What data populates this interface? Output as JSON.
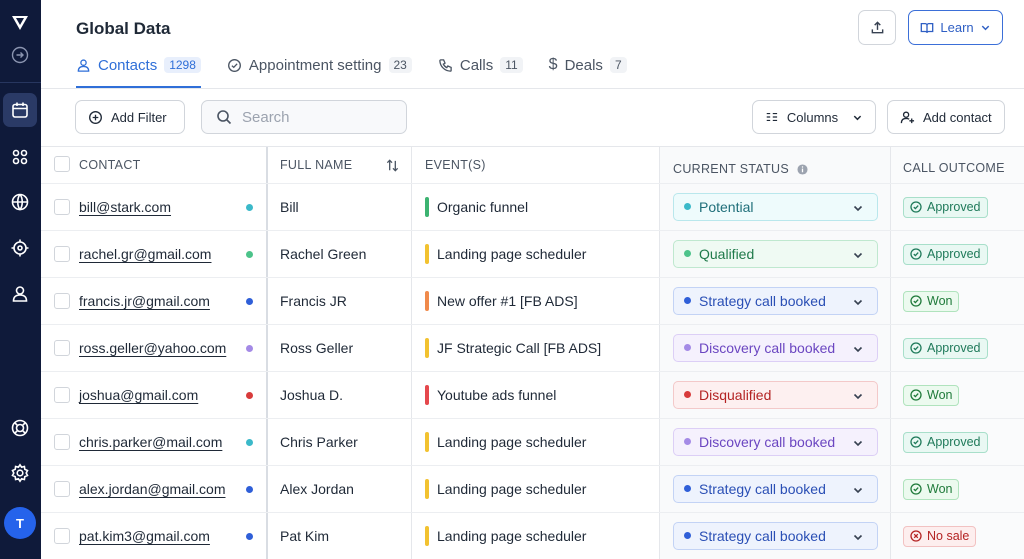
{
  "header": {
    "title": "Global Data",
    "learn_label": "Learn"
  },
  "tabs": [
    {
      "label": "Contacts",
      "count": "1298",
      "icon": "contacts-icon"
    },
    {
      "label": "Appointment setting",
      "count": "23",
      "icon": "check-circle-icon"
    },
    {
      "label": "Calls",
      "count": "11",
      "icon": "phone-icon"
    },
    {
      "label": "Deals",
      "count": "7",
      "icon": "dollar-icon"
    }
  ],
  "toolbar": {
    "add_filter": "Add Filter",
    "search_placeholder": "Search",
    "columns": "Columns",
    "add_contact": "Add contact"
  },
  "columns": {
    "contact": "CONTACT",
    "full_name": "FULL NAME",
    "events": "EVENT(S)",
    "current_status": "CURRENT STATUS",
    "call_outcome": "CALL OUTCOME"
  },
  "user_initial": "T",
  "colors": {
    "accent": "#2f6fd8",
    "sidebar": "#0f1a3a"
  },
  "rows": [
    {
      "email": "bill@stark.com",
      "dot": "#3bb9c9",
      "name": "Bill",
      "event": "Organic funnel",
      "event_color": "#3cb371",
      "status": "Potential",
      "status_key": "potential",
      "outcome": "Approved",
      "outcome_key": "approved"
    },
    {
      "email": "rachel.gr@gmail.com",
      "dot": "#4cc38a",
      "name": "Rachel Green",
      "event": "Landing page scheduler",
      "event_color": "#f2c230",
      "status": "Qualified",
      "status_key": "qualified",
      "outcome": "Approved",
      "outcome_key": "approved"
    },
    {
      "email": "francis.jr@gmail.com",
      "dot": "#2f5fd8",
      "name": "Francis JR",
      "event": "New offer #1 [FB ADS]",
      "event_color": "#f08a4b",
      "status": "Strategy call booked",
      "status_key": "strategy",
      "outcome": "Won",
      "outcome_key": "won"
    },
    {
      "email": "ross.geller@yahoo.com",
      "dot": "#a48ae6",
      "name": "Ross Geller",
      "event": "JF Strategic Call [FB ADS]",
      "event_color": "#f2c230",
      "status": "Discovery call booked",
      "status_key": "discovery",
      "outcome": "Approved",
      "outcome_key": "approved"
    },
    {
      "email": "joshua@gmail.com",
      "dot": "#d83b3b",
      "name": "Joshua D.",
      "event": "Youtube ads funnel",
      "event_color": "#e5484d",
      "status": "Disqualified",
      "status_key": "disqualified",
      "outcome": "Won",
      "outcome_key": "won"
    },
    {
      "email": "chris.parker@mail.com",
      "dot": "#3bb9c9",
      "name": "Chris Parker",
      "event": "Landing page scheduler",
      "event_color": "#f2c230",
      "status": "Discovery call booked",
      "status_key": "discovery",
      "outcome": "Approved",
      "outcome_key": "approved"
    },
    {
      "email": "alex.jordan@gmail.com",
      "dot": "#2f5fd8",
      "name": "Alex Jordan",
      "event": "Landing page scheduler",
      "event_color": "#f2c230",
      "status": "Strategy call booked",
      "status_key": "strategy",
      "outcome": "Won",
      "outcome_key": "won"
    },
    {
      "email": "pat.kim3@gmail.com",
      "dot": "#2f5fd8",
      "name": "Pat Kim",
      "event": "Landing page scheduler",
      "event_color": "#f2c230",
      "status": "Strategy call booked",
      "status_key": "strategy",
      "outcome": "No sale",
      "outcome_key": "nosale"
    }
  ]
}
